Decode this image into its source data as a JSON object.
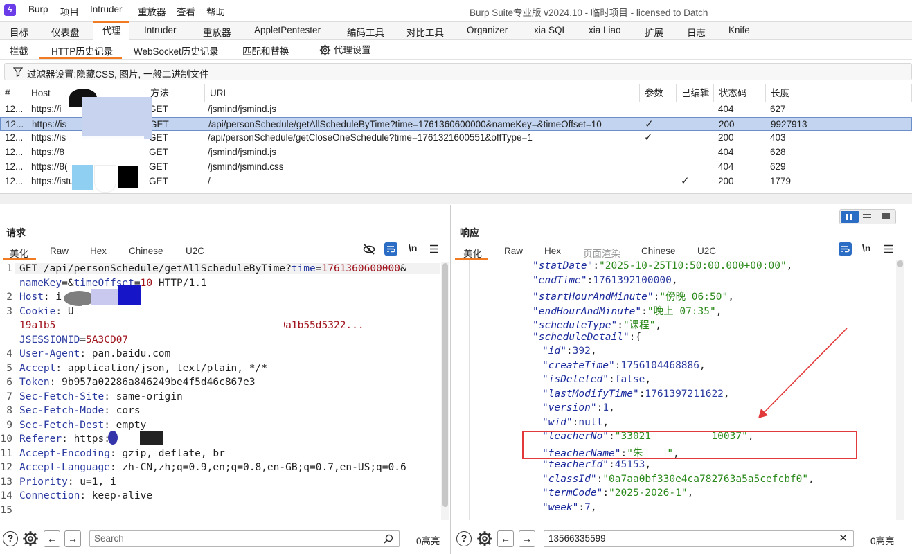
{
  "menu": {
    "app": "Burp",
    "items": [
      "项目",
      "Intruder",
      "重放器",
      "查看",
      "帮助"
    ],
    "window_title": "Burp Suite专业版  v2024.10 - 临时项目 - licensed to Datch"
  },
  "main_tabs": [
    "目标",
    "仪表盘",
    "代理",
    "Intruder",
    "重放器",
    "AppletPentester",
    "编码工具",
    "对比工具",
    "Organizer",
    "xia SQL",
    "xia Liao",
    "扩展",
    "日志",
    "Knife"
  ],
  "active_main_tab": "代理",
  "proxy_tabs": [
    "拦截",
    "HTTP历史记录",
    "WebSocket历史记录",
    "匹配和替换",
    "代理设置"
  ],
  "active_proxy_tab": "HTTP历史记录",
  "filter": {
    "text": "过滤器设置:隐藏CSS, 图片, 一般二进制文件"
  },
  "table": {
    "headers": [
      "#",
      "Host",
      "方法",
      "URL",
      "参数",
      "已编辑",
      "状态码",
      "长度"
    ],
    "rows": [
      {
        "num": "12...",
        "host": "https://i",
        "method": "GET",
        "url": "/jsmind/jsmind.js",
        "params": "",
        "edited": "",
        "status": "404",
        "length": "627"
      },
      {
        "num": "12...",
        "host": "https://is",
        "method": "GET",
        "url": "/api/personSchedule/getAllScheduleByTime?time=1761360600000&nameKey=&timeOffset=10",
        "params": "✓",
        "edited": "",
        "status": "200",
        "length": "9927913",
        "selected": true
      },
      {
        "num": "12...",
        "host": "https://is",
        "method": "GET",
        "url": "/api/personSchedule/getCloseOneSchedule?time=1761321600551&offType=1",
        "params": "✓",
        "edited": "",
        "status": "200",
        "length": "403"
      },
      {
        "num": "12...",
        "host": "https://8",
        "method": "GET",
        "url": "/jsmind/jsmind.js",
        "params": "",
        "edited": "",
        "status": "404",
        "length": "628"
      },
      {
        "num": "12...",
        "host": "https://8(",
        "method": "GET",
        "url": "/jsmind/jsmind.css",
        "params": "",
        "edited": "",
        "status": "404",
        "length": "629"
      },
      {
        "num": "12...",
        "host": "https://istu",
        "method": "GET",
        "url": "/",
        "params": "",
        "edited": "✓",
        "status": "200",
        "length": "1779"
      }
    ]
  },
  "request": {
    "title": "请求",
    "tabs": [
      "美化",
      "Raw",
      "Hex",
      "Chinese",
      "U2C"
    ],
    "active_tab": "美化",
    "lines": [
      {
        "n": "1",
        "parts": [
          {
            "t": "GET /api/personSchedule/getAllScheduleByTime?",
            "c": "v"
          },
          {
            "t": "time",
            "c": "k"
          },
          {
            "t": "=",
            "c": "v"
          },
          {
            "t": "1761360600000",
            "c": "red"
          },
          {
            "t": "&",
            "c": "v"
          }
        ]
      },
      {
        "n": "",
        "parts": [
          {
            "t": "nameKey",
            "c": "k"
          },
          {
            "t": "=&",
            "c": "v"
          },
          {
            "t": "timeOffset",
            "c": "k"
          },
          {
            "t": "=",
            "c": "v"
          },
          {
            "t": "10",
            "c": "red"
          },
          {
            "t": " HTTP/1.1",
            "c": "v"
          }
        ]
      },
      {
        "n": "2",
        "parts": [
          {
            "t": "Host",
            "c": "k"
          },
          {
            "t": ": i",
            "c": "v"
          }
        ]
      },
      {
        "n": "3",
        "parts": [
          {
            "t": "Cookie",
            "c": "k"
          },
          {
            "t": ": U",
            "c": "v"
          }
        ]
      },
      {
        "n": "",
        "parts": [
          {
            "t": "19a1b5",
            "c": "red"
          },
          {
            "t": "                                   ",
            "c": "v"
          },
          {
            "t": "-19a1b55d5322...",
            "c": "red"
          }
        ]
      },
      {
        "n": "",
        "parts": [
          {
            "t": "JSESSIONID",
            "c": "k"
          },
          {
            "t": "=",
            "c": "v"
          },
          {
            "t": "5A3CD07",
            "c": "red"
          }
        ]
      },
      {
        "n": "4",
        "parts": [
          {
            "t": "User-Agent",
            "c": "k"
          },
          {
            "t": ": pan.baidu.com",
            "c": "v"
          }
        ]
      },
      {
        "n": "5",
        "parts": [
          {
            "t": "Accept",
            "c": "k"
          },
          {
            "t": ": application/json, text/plain, */*",
            "c": "v"
          }
        ]
      },
      {
        "n": "6",
        "parts": [
          {
            "t": "Token",
            "c": "k"
          },
          {
            "t": ": 9b957a02286a846249be4f5d46c867e3",
            "c": "v"
          }
        ]
      },
      {
        "n": "7",
        "parts": [
          {
            "t": "Sec-Fetch-Site",
            "c": "k"
          },
          {
            "t": ": same-origin",
            "c": "v"
          }
        ]
      },
      {
        "n": "8",
        "parts": [
          {
            "t": "Sec-Fetch-Mode",
            "c": "k"
          },
          {
            "t": ": cors",
            "c": "v"
          }
        ]
      },
      {
        "n": "9",
        "parts": [
          {
            "t": "Sec-Fetch-Dest",
            "c": "k"
          },
          {
            "t": ": empty",
            "c": "v"
          }
        ]
      },
      {
        "n": "10",
        "parts": [
          {
            "t": "Referer",
            "c": "k"
          },
          {
            "t": ": https:",
            "c": "v"
          }
        ]
      },
      {
        "n": "11",
        "parts": [
          {
            "t": "Accept-Encoding",
            "c": "k"
          },
          {
            "t": ": gzip, deflate, br",
            "c": "v"
          }
        ]
      },
      {
        "n": "12",
        "parts": [
          {
            "t": "Accept-Language",
            "c": "k"
          },
          {
            "t": ": zh-CN,zh;q=0.9,en;q=0.8,en-GB;q=0.7,en-US;q=0.6",
            "c": "v"
          }
        ]
      },
      {
        "n": "13",
        "parts": [
          {
            "t": "Priority",
            "c": "k"
          },
          {
            "t": ": u=1, i",
            "c": "v"
          }
        ]
      },
      {
        "n": "14",
        "parts": [
          {
            "t": "Connection",
            "c": "k"
          },
          {
            "t": ": keep-alive",
            "c": "v"
          }
        ]
      },
      {
        "n": "15",
        "parts": []
      }
    ],
    "search_placeholder": "Search",
    "highlight_count": "0高亮"
  },
  "response": {
    "title": "响应",
    "tabs": [
      "美化",
      "Raw",
      "Hex",
      "页面渲染",
      "Chinese",
      "U2C"
    ],
    "active_tab": "美化",
    "lines": [
      {
        "indent": 0,
        "parts": [
          {
            "t": "\"statDate\"",
            "c": "js-k"
          },
          {
            "t": ":",
            "c": "v"
          },
          {
            "t": "\"2025-10-25T10:50:00.000+00:00\"",
            "c": "js-s"
          },
          {
            "t": ",",
            "c": "v"
          }
        ]
      },
      {
        "indent": 0,
        "parts": [
          {
            "t": "\"endTime\"",
            "c": "js-k"
          },
          {
            "t": ":",
            "c": "v"
          },
          {
            "t": "1761392100000",
            "c": "js-n"
          },
          {
            "t": ",",
            "c": "v"
          }
        ]
      },
      {
        "indent": 0,
        "parts": [
          {
            "t": "\"startHourAndMinute\"",
            "c": "js-k"
          },
          {
            "t": ":",
            "c": "v"
          },
          {
            "t": "\"傍晚 06:50\"",
            "c": "js-s"
          },
          {
            "t": ",",
            "c": "v"
          }
        ]
      },
      {
        "indent": 0,
        "parts": [
          {
            "t": "\"endHourAndMinute\"",
            "c": "js-k"
          },
          {
            "t": ":",
            "c": "v"
          },
          {
            "t": "\"晚上 07:35\"",
            "c": "js-s"
          },
          {
            "t": ",",
            "c": "v"
          }
        ]
      },
      {
        "indent": 0,
        "parts": [
          {
            "t": "\"scheduleType\"",
            "c": "js-k"
          },
          {
            "t": ":",
            "c": "v"
          },
          {
            "t": "\"课程\"",
            "c": "js-s"
          },
          {
            "t": ",",
            "c": "v"
          }
        ]
      },
      {
        "indent": 0,
        "parts": [
          {
            "t": "\"scheduleDetail\"",
            "c": "js-k"
          },
          {
            "t": ":{",
            "c": "v"
          }
        ]
      },
      {
        "indent": 1,
        "parts": [
          {
            "t": "\"id\"",
            "c": "js-k"
          },
          {
            "t": ":",
            "c": "v"
          },
          {
            "t": "392",
            "c": "js-n"
          },
          {
            "t": ",",
            "c": "v"
          }
        ]
      },
      {
        "indent": 1,
        "parts": [
          {
            "t": "\"createTime\"",
            "c": "js-k"
          },
          {
            "t": ":",
            "c": "v"
          },
          {
            "t": "1756104468886",
            "c": "js-n"
          },
          {
            "t": ",",
            "c": "v"
          }
        ]
      },
      {
        "indent": 1,
        "parts": [
          {
            "t": "\"isDeleted\"",
            "c": "js-k"
          },
          {
            "t": ":",
            "c": "v"
          },
          {
            "t": "false",
            "c": "js-n"
          },
          {
            "t": ",",
            "c": "v"
          }
        ]
      },
      {
        "indent": 1,
        "parts": [
          {
            "t": "\"lastModifyTime\"",
            "c": "js-k"
          },
          {
            "t": ":",
            "c": "v"
          },
          {
            "t": "1761397211622",
            "c": "js-n"
          },
          {
            "t": ",",
            "c": "v"
          }
        ]
      },
      {
        "indent": 1,
        "parts": [
          {
            "t": "\"version\"",
            "c": "js-k"
          },
          {
            "t": ":",
            "c": "v"
          },
          {
            "t": "1",
            "c": "js-n"
          },
          {
            "t": ",",
            "c": "v"
          }
        ]
      },
      {
        "indent": 1,
        "parts": [
          {
            "t": "\"wid\"",
            "c": "js-k"
          },
          {
            "t": ":",
            "c": "v"
          },
          {
            "t": "null",
            "c": "js-n"
          },
          {
            "t": ",",
            "c": "v"
          }
        ]
      },
      {
        "indent": 1,
        "parts": [
          {
            "t": "\"teacherNo\"",
            "c": "js-k"
          },
          {
            "t": ":",
            "c": "v"
          },
          {
            "t": "\"33021          10037\"",
            "c": "js-s"
          },
          {
            "t": ",",
            "c": "v"
          }
        ]
      },
      {
        "indent": 1,
        "parts": [
          {
            "t": "\"teacherName\"",
            "c": "js-k"
          },
          {
            "t": ":",
            "c": "v"
          },
          {
            "t": "\"朱    \"",
            "c": "js-s"
          },
          {
            "t": ",",
            "c": "v"
          }
        ]
      },
      {
        "indent": 1,
        "parts": [
          {
            "t": "\"teacherId\"",
            "c": "js-k"
          },
          {
            "t": ":",
            "c": "v"
          },
          {
            "t": "45153",
            "c": "js-n"
          },
          {
            "t": ",",
            "c": "v"
          }
        ]
      },
      {
        "indent": 1,
        "parts": [
          {
            "t": "\"classId\"",
            "c": "js-k"
          },
          {
            "t": ":",
            "c": "v"
          },
          {
            "t": "\"0a7aa0bf330e4ca782763a5a5cefcbf0\"",
            "c": "js-s"
          },
          {
            "t": ",",
            "c": "v"
          }
        ]
      },
      {
        "indent": 1,
        "parts": [
          {
            "t": "\"termCode\"",
            "c": "js-k"
          },
          {
            "t": ":",
            "c": "v"
          },
          {
            "t": "\"2025-2026-1\"",
            "c": "js-s"
          },
          {
            "t": ",",
            "c": "v"
          }
        ]
      },
      {
        "indent": 1,
        "parts": [
          {
            "t": "\"week\"",
            "c": "js-k"
          },
          {
            "t": ":",
            "c": "v"
          },
          {
            "t": "7",
            "c": "js-n"
          },
          {
            "t": ",",
            "c": "v"
          }
        ]
      }
    ],
    "search_value": "13566335599",
    "highlight_count": "0高亮"
  },
  "colors": {
    "accent": "#f07b22",
    "selection": "#c3d4f0",
    "annotation": "#e23a3a"
  }
}
